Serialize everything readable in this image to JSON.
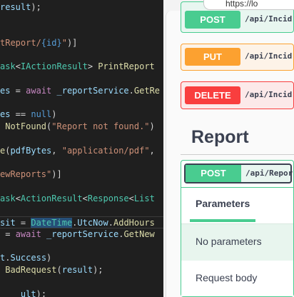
{
  "editor": {
    "lines": [
      [
        [
          "var",
          "result"
        ],
        [
          "p",
          ");"
        ]
      ],
      [],
      [],
      [
        [
          "str",
          "tReport/"
        ],
        [
          "kw",
          "{id}"
        ],
        [
          "str",
          "\""
        ],
        [
          "p",
          ")]"
        ]
      ],
      [],
      [
        [
          "type",
          "ask"
        ],
        [
          "p",
          "<"
        ],
        [
          "type",
          "IActionResult"
        ],
        [
          "p",
          "> "
        ],
        [
          "fn",
          "PrintReport"
        ]
      ],
      [],
      [
        [
          "var",
          "es"
        ],
        [
          "p",
          " = "
        ],
        [
          "ctl",
          "await"
        ],
        [
          "p",
          " "
        ],
        [
          "var",
          "_reportService"
        ],
        [
          "p",
          "."
        ],
        [
          "fn",
          "GetRe"
        ]
      ],
      [],
      [
        [
          "var",
          "es"
        ],
        [
          "p",
          " == "
        ],
        [
          "kw",
          "null"
        ],
        [
          "p",
          ")"
        ]
      ],
      [
        [
          "p",
          " "
        ],
        [
          "fn",
          "NotFound"
        ],
        [
          "p",
          "("
        ],
        [
          "str",
          "\"Report not found.\""
        ],
        [
          "p",
          ")"
        ]
      ],
      [],
      [
        [
          "fn",
          "e"
        ],
        [
          "p",
          "("
        ],
        [
          "var",
          "pdfBytes"
        ],
        [
          "p",
          ", "
        ],
        [
          "str",
          "\"application/pdf\""
        ],
        [
          "p",
          ","
        ]
      ],
      [],
      [
        [
          "str",
          "ewReports\""
        ],
        [
          "p",
          ")]"
        ]
      ],
      [],
      [
        [
          "type",
          "ask"
        ],
        [
          "p",
          "<"
        ],
        [
          "type",
          "ActionResult"
        ],
        [
          "p",
          "<"
        ],
        [
          "type",
          "Response"
        ],
        [
          "p",
          "<"
        ],
        [
          "type",
          "List"
        ]
      ],
      [],
      [
        [
          "var",
          "sit"
        ],
        [
          "p",
          " = "
        ],
        [
          "sel",
          "DateTime"
        ],
        [
          "p",
          "."
        ],
        [
          "var",
          "UtcNow"
        ],
        [
          "p",
          "."
        ],
        [
          "fn",
          "AddHours"
        ]
      ],
      [
        [
          "p",
          " = "
        ],
        [
          "ctl",
          "await"
        ],
        [
          "p",
          " "
        ],
        [
          "var",
          "_reportService"
        ],
        [
          "p",
          "."
        ],
        [
          "fn",
          "GetNew"
        ]
      ],
      [],
      [
        [
          "var",
          "t"
        ],
        [
          "p",
          "."
        ],
        [
          "var",
          "Success"
        ],
        [
          "p",
          ")"
        ]
      ],
      [
        [
          "p",
          " "
        ],
        [
          "fn",
          "BadRequest"
        ],
        [
          "p",
          "("
        ],
        [
          "var",
          "result"
        ],
        [
          "p",
          ");"
        ]
      ],
      [],
      [
        [
          "p",
          "    "
        ],
        [
          "var",
          "ult"
        ],
        [
          "p",
          ");"
        ]
      ]
    ],
    "current_line": 18
  },
  "browser": {
    "address": "https://lo"
  },
  "swagger": {
    "ops": [
      {
        "method": "POST",
        "path": "/api/Incid",
        "color": "#49cc90",
        "bg": "#e8f6f0"
      },
      {
        "method": "PUT",
        "path": "/api/Incid",
        "color": "#fca130",
        "bg": "#fdf3e8"
      },
      {
        "method": "DELETE",
        "path": "/api/Incid",
        "color": "#f93e3e",
        "bg": "#fce9e9"
      }
    ],
    "section_title": "Report",
    "expanded": {
      "method": "POST",
      "path": "/api/Repor",
      "tab": "Parameters",
      "no_params": "No parameters",
      "request_body": "Request body"
    }
  }
}
